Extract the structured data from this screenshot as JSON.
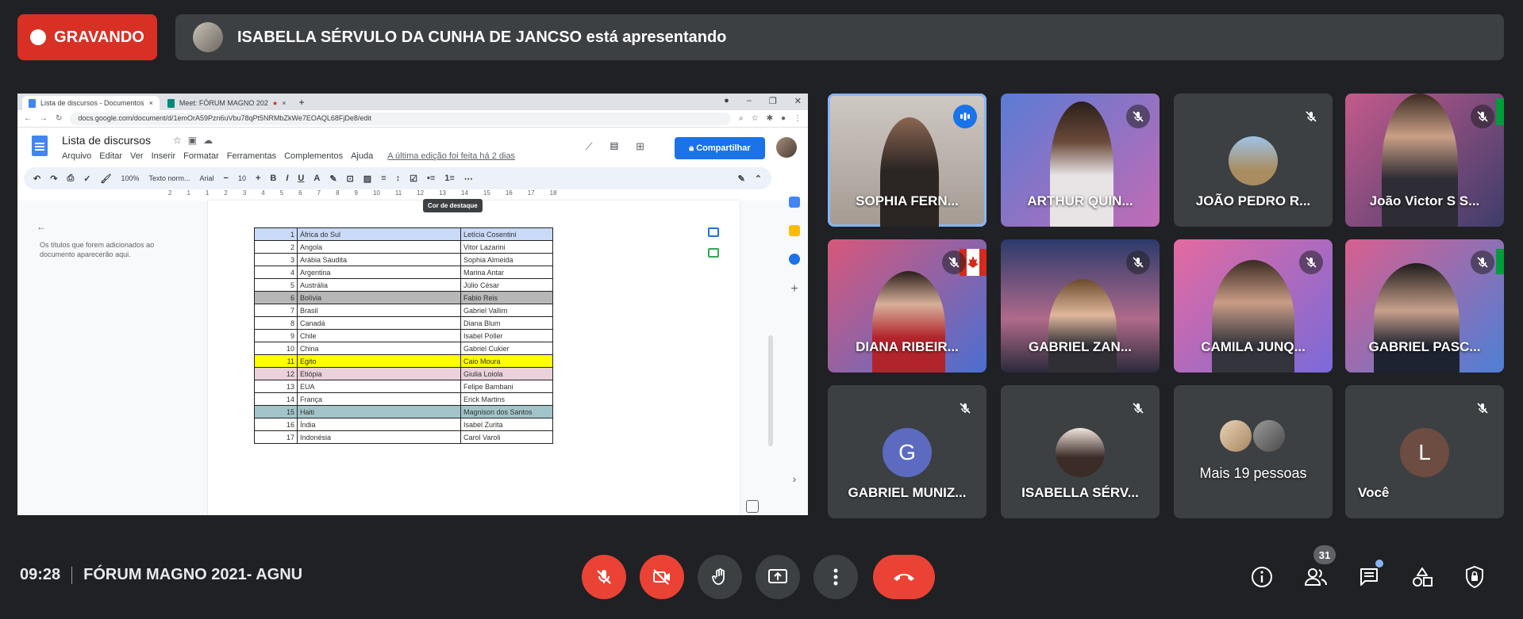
{
  "recording": {
    "label": "GRAVANDO"
  },
  "presenter": {
    "text": "ISABELLA SÉRVULO DA CUNHA DE JANCSO está apresentando"
  },
  "browser": {
    "tabs": [
      {
        "label": "Lista de discursos - Documentos",
        "close": "×"
      },
      {
        "label": "Meet: FÓRUM MAGNO 202",
        "close": "×"
      }
    ],
    "new_tab": "+",
    "url": "docs.google.com/document/d/1emOrA59Pzn6uVbu78qPt5NRMbZkWe7EOAQL68FjDe8/edit"
  },
  "docs": {
    "title": "Lista de discursos",
    "menus": [
      "Arquivo",
      "Editar",
      "Ver",
      "Inserir",
      "Formatar",
      "Ferramentas",
      "Complementos",
      "Ajuda"
    ],
    "last_edit": "A última edição foi feita há 2 dias",
    "share_label": "Compartilhar",
    "toolbar": {
      "zoom": "100%",
      "style": "Texto norm...",
      "font": "Arial",
      "size": "10"
    },
    "tooltip": "Cor de destaque",
    "ruler": [
      "2",
      "1",
      "1",
      "2",
      "3",
      "4",
      "5",
      "6",
      "7",
      "8",
      "9",
      "10",
      "11",
      "12",
      "13",
      "14",
      "15",
      "16",
      "17",
      "18"
    ],
    "outline_text": "Os títulos que forem adicionados ao documento aparecerão aqui.",
    "rows": [
      {
        "n": "1",
        "country": "África do Sul",
        "speaker": "Letícia Cosentini",
        "color": "#c9daf8"
      },
      {
        "n": "2",
        "country": "Angola",
        "speaker": "Vitor Lazarini",
        "color": "#ffffff"
      },
      {
        "n": "3",
        "country": "Arábia Saudita",
        "speaker": "Sophia Almeida",
        "color": "#ffffff"
      },
      {
        "n": "4",
        "country": "Argentina",
        "speaker": "Marina Antar",
        "color": "#ffffff"
      },
      {
        "n": "5",
        "country": "Austrália",
        "speaker": "Júlio César",
        "color": "#ffffff"
      },
      {
        "n": "6",
        "country": "Bolívia",
        "speaker": "Fabio Reis",
        "color": "#b7b7b7"
      },
      {
        "n": "7",
        "country": "Brasil",
        "speaker": "Gabriel Vallim",
        "color": "#ffffff"
      },
      {
        "n": "8",
        "country": "Canadá",
        "speaker": "Diana Blum",
        "color": "#ffffff"
      },
      {
        "n": "9",
        "country": "Chile",
        "speaker": "Isabel Poller",
        "color": "#ffffff"
      },
      {
        "n": "10",
        "country": "China",
        "speaker": "Gabriel Cukier",
        "color": "#ffffff"
      },
      {
        "n": "11",
        "country": "Egito",
        "speaker": "Caio Moura",
        "color": "#ffff00"
      },
      {
        "n": "12",
        "country": "Etiópia",
        "speaker": "Giulia Loiola",
        "color": "#ead1dc"
      },
      {
        "n": "13",
        "country": "EUA",
        "speaker": "Felipe Bambani",
        "color": "#ffffff"
      },
      {
        "n": "14",
        "country": "França",
        "speaker": "Erick Martins",
        "color": "#ffffff"
      },
      {
        "n": "15",
        "country": "Haiti",
        "speaker": "Magnison dos Santos",
        "color": "#a2c4c9"
      },
      {
        "n": "16",
        "country": "Índia",
        "speaker": "Isabel Zurita",
        "color": "#ffffff"
      },
      {
        "n": "17",
        "country": "Indonésia",
        "speaker": "Carol Varoli",
        "color": "#ffffff"
      }
    ]
  },
  "tiles": [
    {
      "name": "SOPHIA FERN..."
    },
    {
      "name": "ARTHUR QUIN..."
    },
    {
      "name": "JOÃO PEDRO R..."
    },
    {
      "name": "João Victor S S..."
    },
    {
      "name": "DIANA RIBEIR..."
    },
    {
      "name": "GABRIEL ZAN..."
    },
    {
      "name": "CAMILA JUNQ..."
    },
    {
      "name": "GABRIEL PASC..."
    },
    {
      "name": "GABRIEL MUNIZ...",
      "initial": "G",
      "color": "#5c6bc0"
    },
    {
      "name": "ISABELLA SÉRV..."
    },
    {
      "name": "Mais 19 pessoas"
    },
    {
      "name": "Você",
      "initial": "L",
      "color": "#6d4c41"
    }
  ],
  "bottom": {
    "time": "09:28",
    "meeting": "FÓRUM MAGNO 2021- AGNU",
    "participants_count": "31"
  },
  "colors": {
    "red": "#ea4335",
    "bg": "#202124",
    "tile": "#3c4043",
    "accent": "#1a73e8"
  }
}
